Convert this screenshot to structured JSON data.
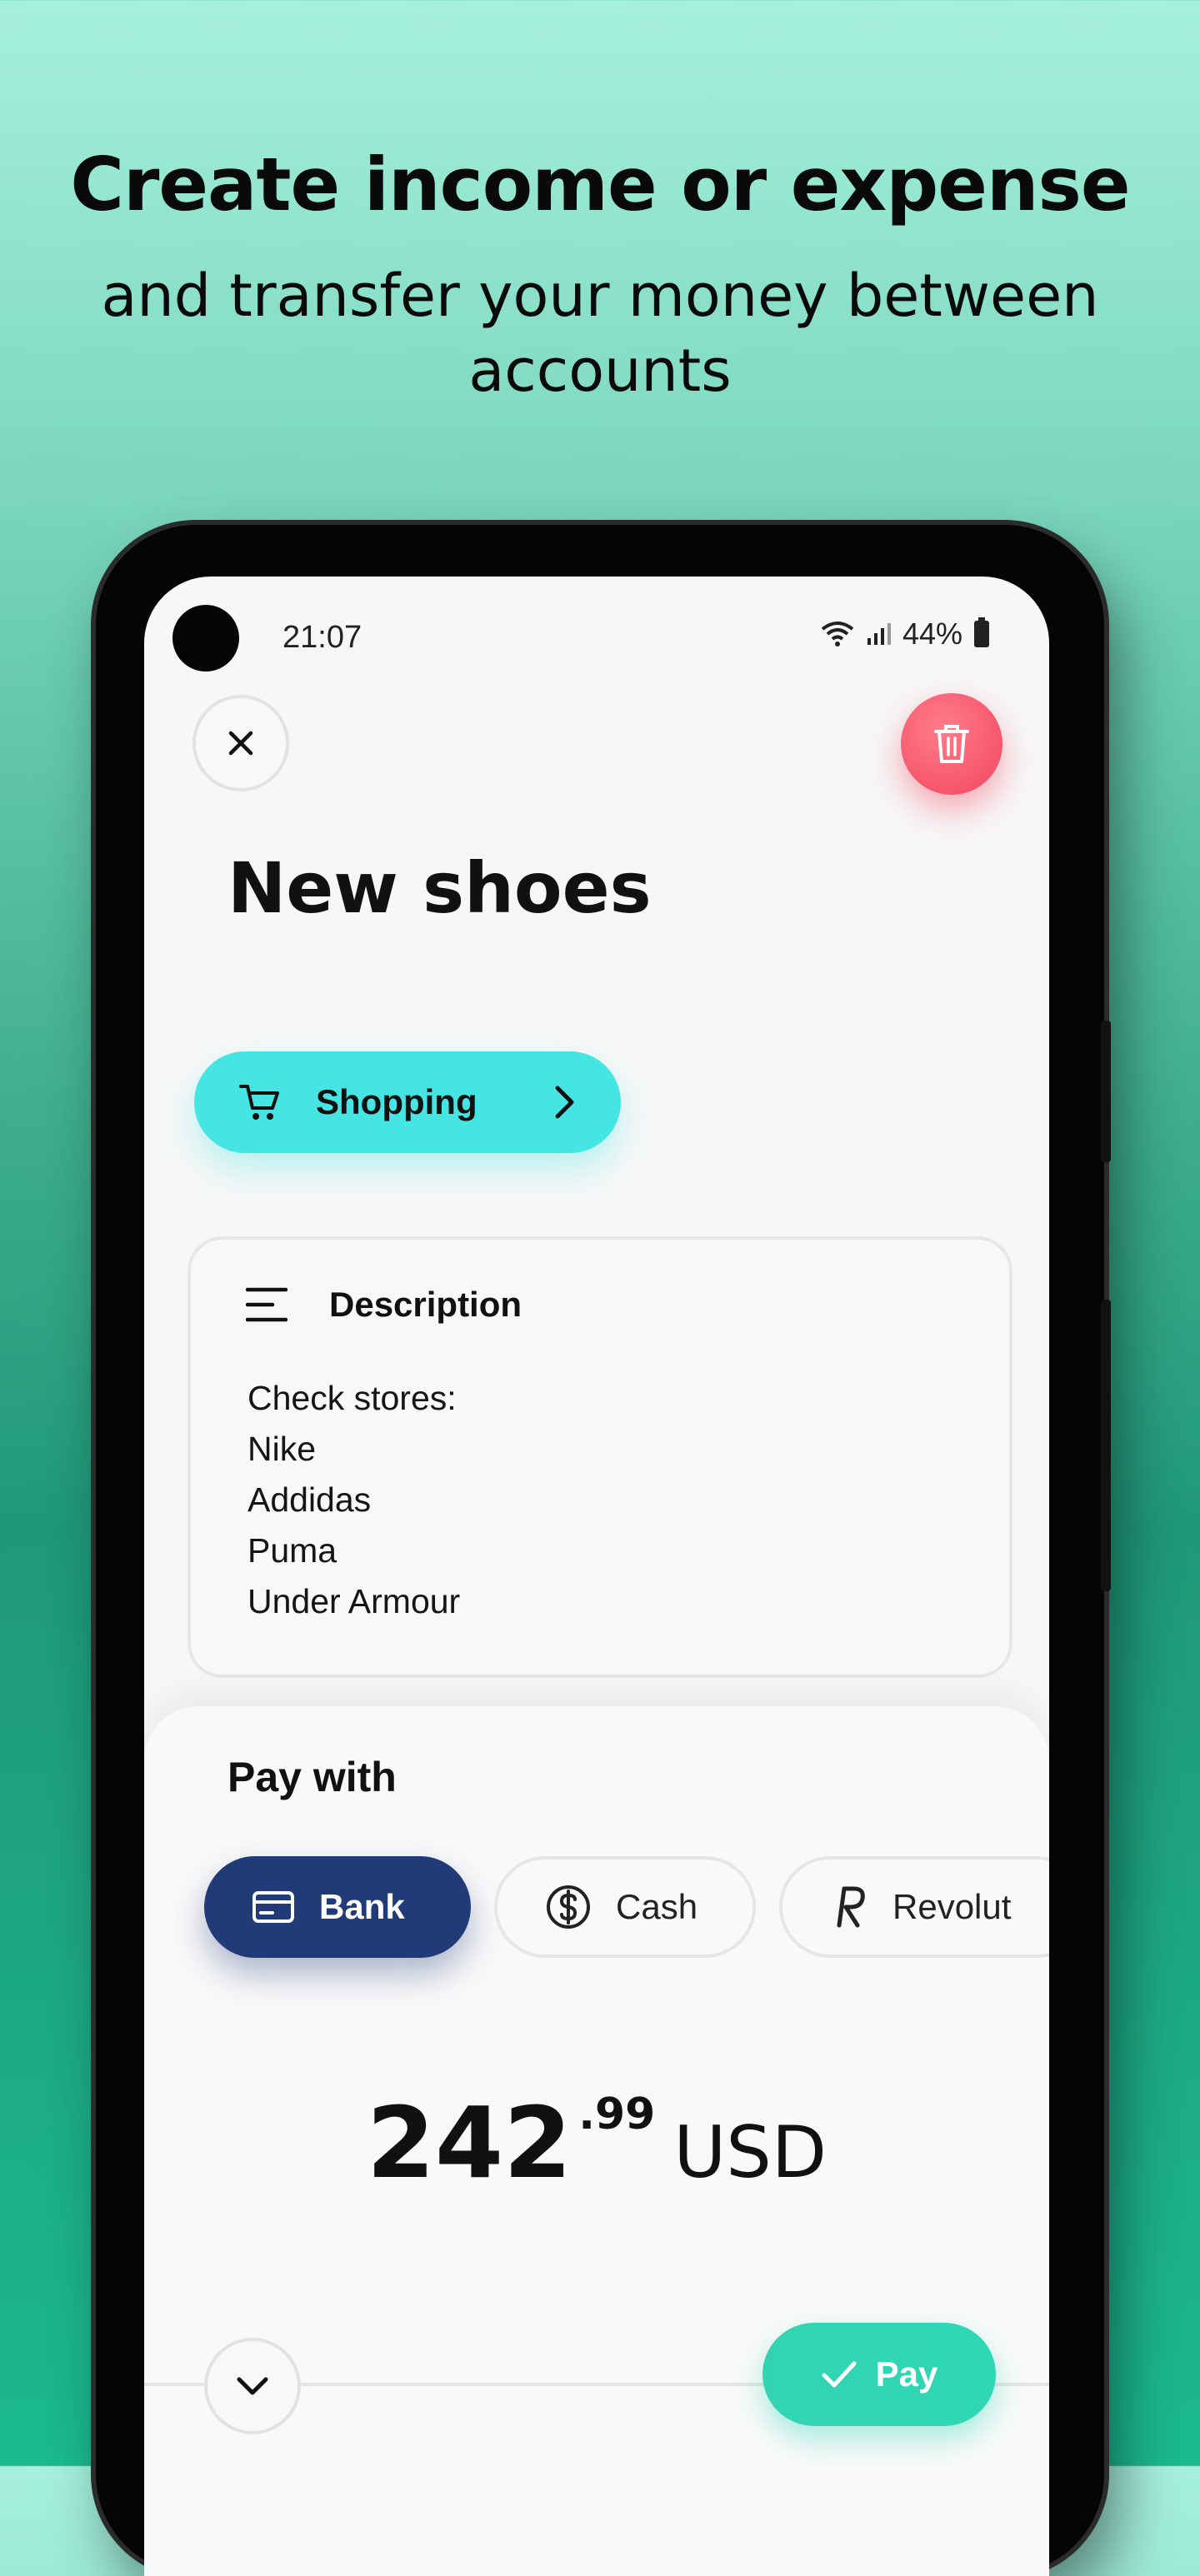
{
  "promo": {
    "headline": "Create income or expense",
    "subline": "and transfer your money between accounts"
  },
  "status_bar": {
    "time": "21:07",
    "battery": "44%"
  },
  "transaction": {
    "title": "New shoes",
    "category": "Shopping",
    "description_label": "Description",
    "description_lines": [
      "Check stores:",
      "Nike",
      "Addidas",
      "Puma",
      "Under Armour"
    ]
  },
  "pay_with": {
    "title": "Pay with",
    "accounts": [
      {
        "label": "Bank",
        "icon": "card-icon",
        "selected": true
      },
      {
        "label": "Cash",
        "icon": "dollar-icon",
        "selected": false
      },
      {
        "label": "Revolut",
        "icon": "revolut-icon",
        "selected": false
      }
    ]
  },
  "amount": {
    "integer": "242",
    "decimal": ".99",
    "currency": "USD"
  },
  "actions": {
    "pay_label": "Pay"
  },
  "colors": {
    "category_accent": "#45e5e4",
    "selected_account": "#213a78",
    "delete": "#f2465f",
    "pay": "#2ed8b4"
  }
}
